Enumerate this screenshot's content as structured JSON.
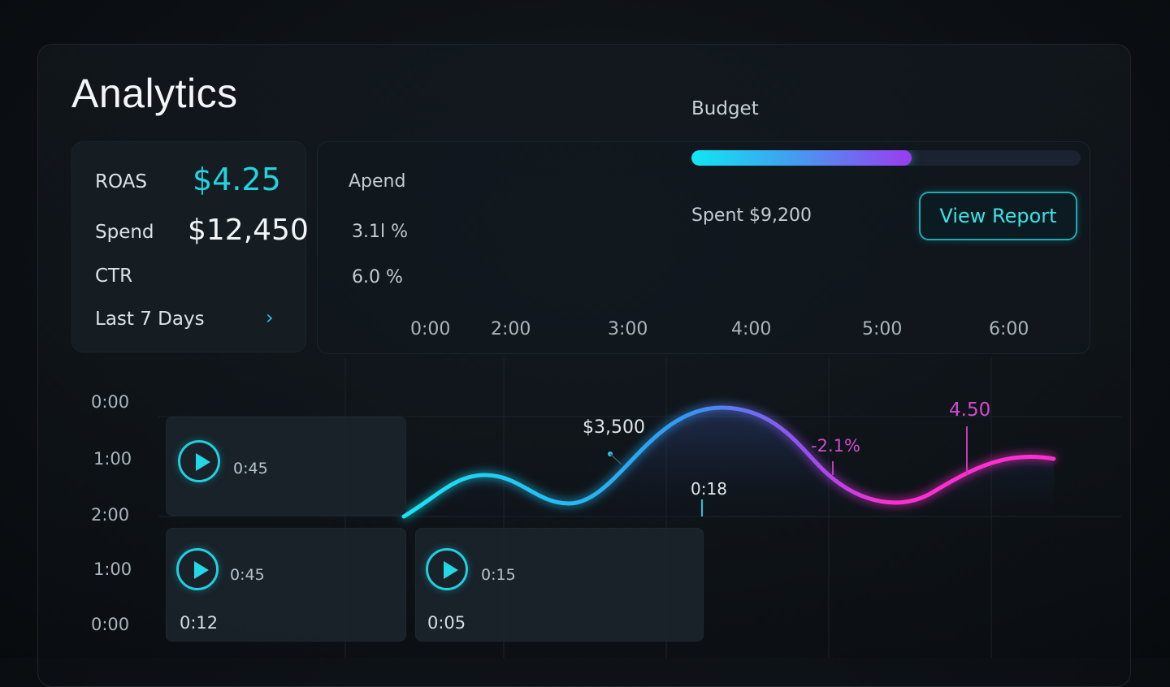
{
  "header": {
    "title": "Analytics"
  },
  "metrics": {
    "roas_label": "ROAS",
    "roas_value": "$4.25",
    "spend_label": "Spend",
    "spend_value": "$12,450",
    "ctr_label": "CTR",
    "range_label": "Last 7 Days",
    "range_chevron": "›"
  },
  "middle": {
    "label": "Apend",
    "value1": "3.1l %",
    "value2": "6.0 %",
    "x_ticks": [
      "0:00",
      "2:00",
      "3:00",
      "4:00",
      "5:00",
      "6:00"
    ]
  },
  "budget": {
    "title": "Budget",
    "fill_fraction": 0.565,
    "spent_text": "Spent $9,200",
    "view_report_label": "View Report"
  },
  "timeline": {
    "y_ticks": [
      "0:00",
      "1:00",
      "2:00",
      "1:00",
      "0:00"
    ],
    "clips": [
      {
        "duration": "0:45",
        "time": ""
      },
      {
        "duration": "0:45",
        "time": "0:12"
      },
      {
        "duration": "0:15",
        "time": "0:05"
      }
    ]
  },
  "wave": {
    "annotations": {
      "peak_left": "$3,500",
      "marker_mid": "0:18",
      "change": "-2.1%",
      "peak_right": "4.50"
    },
    "colors": {
      "start": "#17e6f5",
      "mid": "#2f9cf2",
      "end": "#ff2fd0"
    }
  }
}
